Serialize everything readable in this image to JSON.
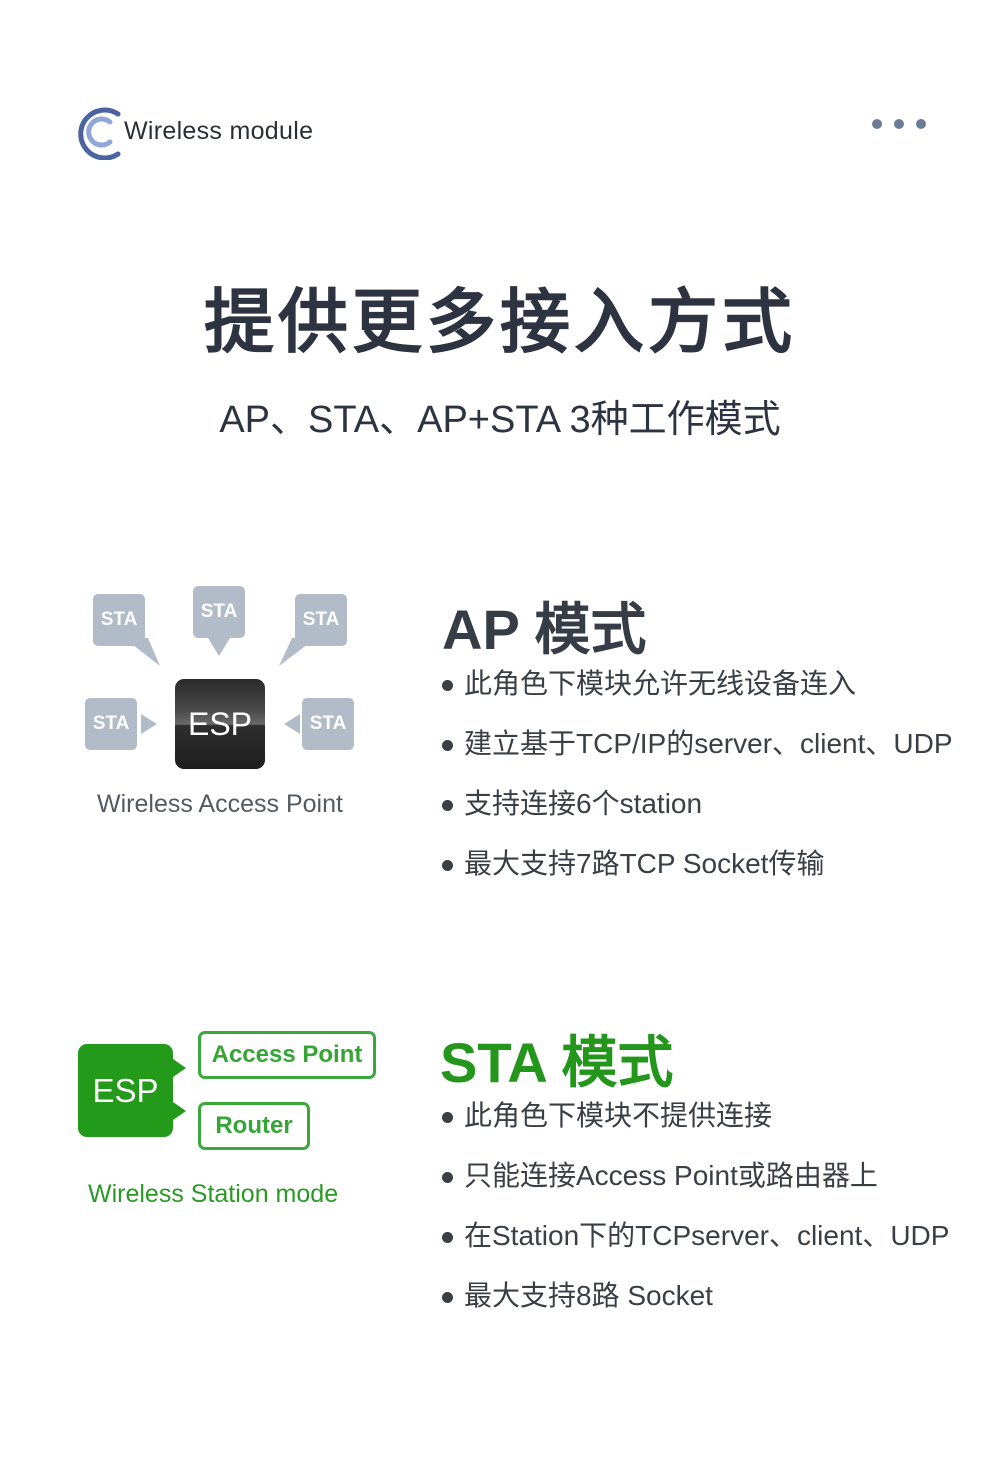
{
  "header": {
    "brand_name": "Wireless module",
    "logo_icon": "crescent-c-logo",
    "menu_icon": "more-dots-icon",
    "colors": {
      "logo_outer": "#4b63a0",
      "logo_inner": "#8fa6d6",
      "menu_dots": "#6b7d96"
    }
  },
  "hero": {
    "title": "提供更多接入方式",
    "subtitle": "AP、STA、AP+STA 3种工作模式"
  },
  "ap_section": {
    "diagram": {
      "center_label": "ESP",
      "stations": [
        "STA",
        "STA",
        "STA",
        "STA",
        "STA"
      ],
      "caption": "Wireless Access Point"
    },
    "heading": "AP 模式",
    "bullets": [
      "此角色下模块允许无线设备连入",
      "建立基于TCP/IP的server、client、UDP",
      "支持连接6个station",
      "最大支持7路TCP Socket传输"
    ],
    "colors": {
      "station_box": "#b2bcc8",
      "heading": "#373d46"
    }
  },
  "sta_section": {
    "diagram": {
      "center_label": "ESP",
      "targets": [
        "Access Point",
        "Router"
      ],
      "caption": "Wireless Station mode"
    },
    "heading": "STA 模式",
    "bullets": [
      "此角色下模块不提供连接",
      "只能连接Access Point或路由器上",
      "在Station下的TCPserver、client、UDP",
      "最大支持8路 Socket"
    ],
    "colors": {
      "accent": "#239a1a",
      "box_border": "#3aa83a"
    }
  }
}
